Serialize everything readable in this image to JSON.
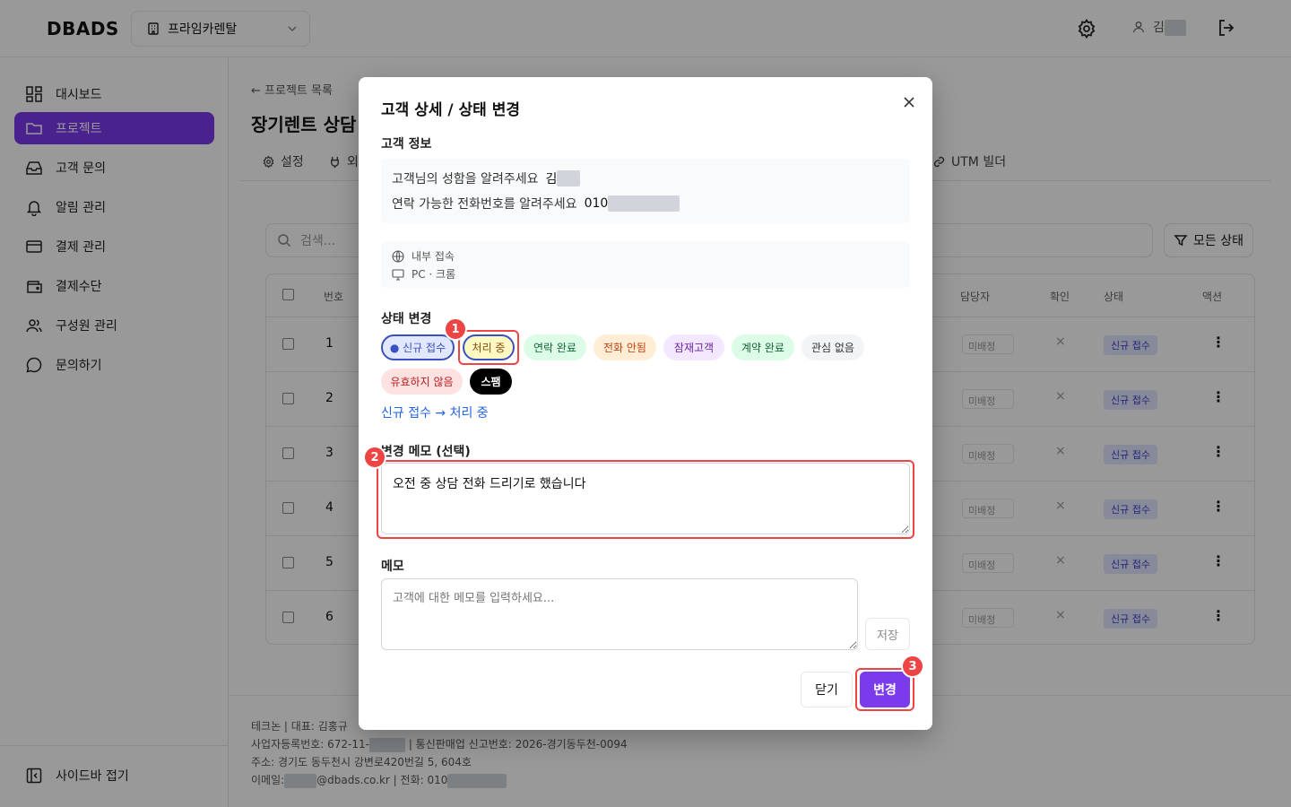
{
  "header": {
    "logo": "DBADS",
    "org_name": "프라임카렌탈",
    "user_initial": "김"
  },
  "sidebar": {
    "items": [
      {
        "label": "대시보드",
        "icon": "grid-icon"
      },
      {
        "label": "프로젝트",
        "icon": "folder-icon",
        "active": true
      },
      {
        "label": "고객 문의",
        "icon": "inbox-icon"
      },
      {
        "label": "알림 관리",
        "icon": "bell-icon"
      },
      {
        "label": "결제 관리",
        "icon": "card-icon"
      },
      {
        "label": "결제수단",
        "icon": "wallet-icon"
      },
      {
        "label": "구성원 관리",
        "icon": "users-icon"
      },
      {
        "label": "문의하기",
        "icon": "chat-icon"
      }
    ],
    "collapse_label": "사이드바 접기"
  },
  "main": {
    "back_link": "← 프로젝트 목록",
    "title": "장기렌트 상담 신",
    "tabs": [
      "설정",
      "외",
      "UTM 빌더"
    ],
    "search_placeholder": "검색...",
    "status_filter": "모든 상태",
    "table": {
      "headers": [
        "번호",
        "담당자",
        "확인",
        "상태",
        "액션"
      ],
      "rows": [
        {
          "num": "1",
          "assignee": "미배정",
          "confirm": "×",
          "status": "신규 접수"
        },
        {
          "num": "2",
          "assignee": "미배정",
          "confirm": "×",
          "status": "신규 접수"
        },
        {
          "num": "3",
          "assignee": "미배정",
          "confirm": "×",
          "status": "신규 접수"
        },
        {
          "num": "4",
          "assignee": "미배정",
          "confirm": "×",
          "status": "신규 접수"
        },
        {
          "num": "5",
          "assignee": "미배정",
          "confirm": "×",
          "status": "신규 접수"
        },
        {
          "num": "6",
          "assignee": "미배정",
          "confirm": "×",
          "status": "신규 접수"
        }
      ]
    },
    "footer": {
      "line1": "테크논 | 대표: 김홍규",
      "line2a": "사업자등록번호: 672-11-",
      "line2b": "| 통신판매업 신고번호: 2026-경기동두천-0094",
      "line3": "주소: 경기도 동두천시 강변로420번길 5, 604호",
      "line4a": "이메일:",
      "line4b": "@dbads.co.kr | 전화: 010"
    }
  },
  "modal": {
    "title": "고객 상세 / 상태 변경",
    "customer_info_label": "고객 정보",
    "name_question": "고객님의 성함을 알려주세요",
    "name_value": "김",
    "phone_question": "연락 가능한 전화번호를 알려주세요",
    "phone_value": "010",
    "meta_access": "내부 접속",
    "meta_device": "PC · 크롬",
    "status_change_label": "상태 변경",
    "statuses": {
      "new": "● 신규 접수",
      "processing": "처리 중",
      "contacted": "연락 완료",
      "no_answer": "전화 안됨",
      "potential": "잠재고객",
      "contracted": "계약 완료",
      "no_interest": "관심 없음",
      "invalid": "유효하지 않음",
      "spam": "스팸"
    },
    "transition_text": "신규 접수 → 처리 중",
    "change_memo_label": "변경 메모 (선택)",
    "change_memo_value": "오전 중 상담 전화 드리기로 했습니다",
    "memo_label": "메모",
    "memo_placeholder": "고객에 대한 메모를 입력하세요...",
    "save_label": "저장",
    "close_label": "닫기",
    "change_label": "변경"
  },
  "annotations": {
    "badge1": "1",
    "badge2": "2",
    "badge3": "3",
    "color": "#ef4444"
  },
  "colors": {
    "accent": "#7c3aed",
    "link": "#2563eb"
  }
}
